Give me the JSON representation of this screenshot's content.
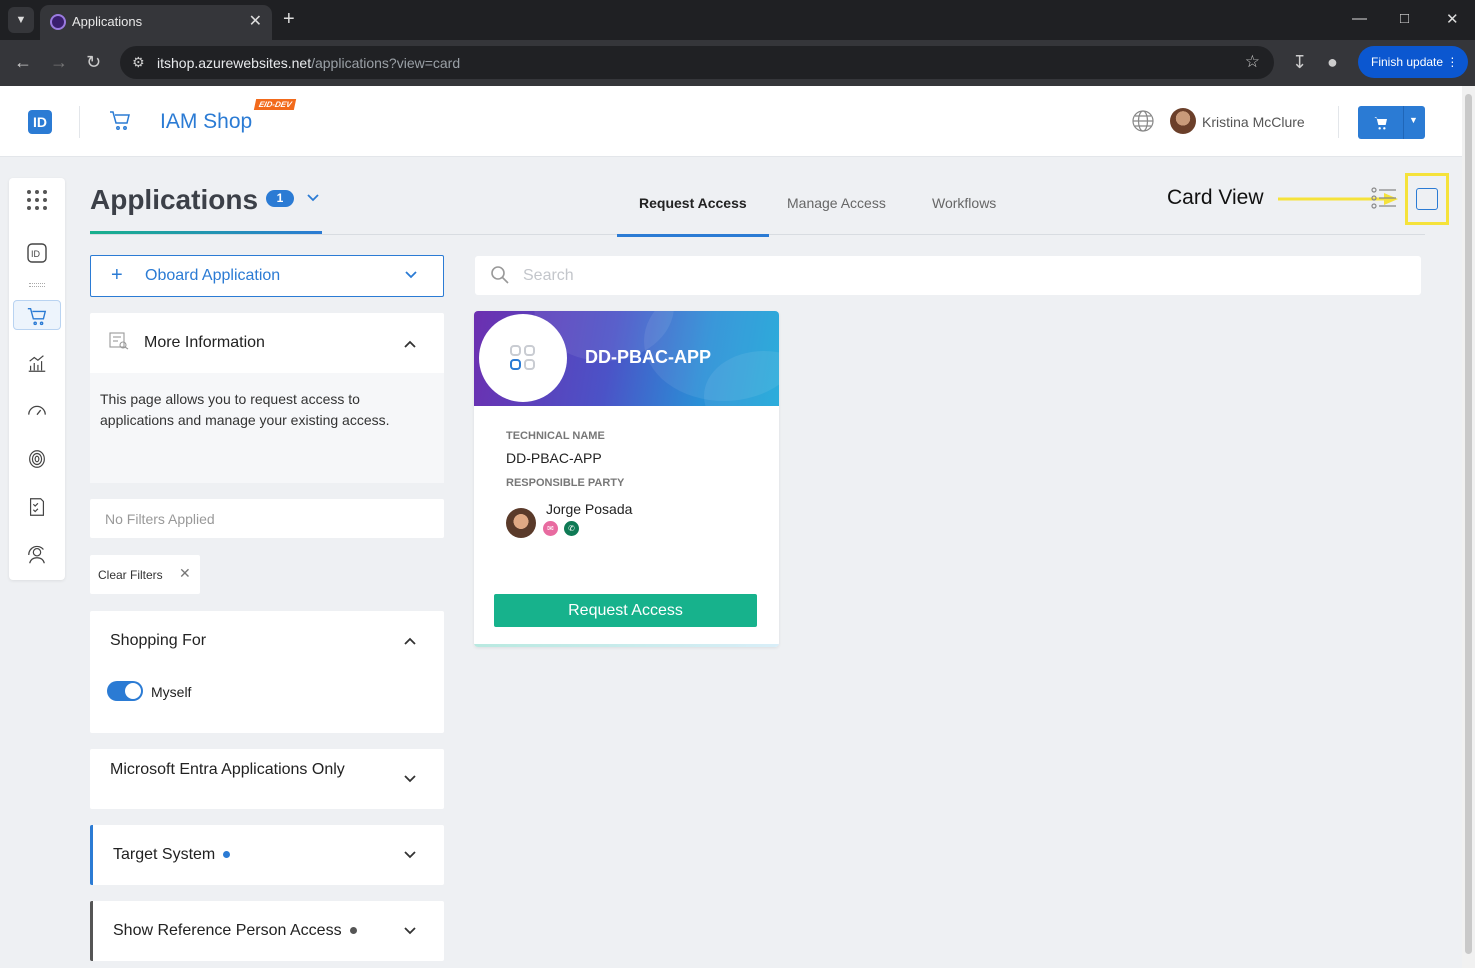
{
  "browser": {
    "tab_title": "Applications",
    "url_host": "itshop.azurewebsites.net",
    "url_path": "/applications?view=card",
    "finish_update": "Finish update"
  },
  "header": {
    "logo_text": "ID",
    "app_title": "IAM Shop",
    "env_badge": "EID-DEV",
    "user_name": "Kristina McClure"
  },
  "page": {
    "title": "Applications",
    "count": "1",
    "tabs": [
      {
        "label": "Request Access",
        "active": true
      },
      {
        "label": "Manage Access",
        "active": false
      },
      {
        "label": "Workflows",
        "active": false
      }
    ]
  },
  "annotation": {
    "text": "Card View",
    "color": "#f5e23a"
  },
  "sidebar_rail": {
    "items": [
      "apps-grid-icon",
      "id-icon",
      "cart-icon",
      "chart-icon",
      "gauge-icon",
      "fingerprint-icon",
      "checklist-icon",
      "user-shield-icon"
    ]
  },
  "filters": {
    "onboard_label": "Oboard Application",
    "more_info": {
      "title": "More Information",
      "body": "This page allows you to request access to applications and manage your existing access."
    },
    "no_filters": "No Filters Applied",
    "clear_filters": "Clear Filters",
    "shopping_for": {
      "title": "Shopping For",
      "toggle_label": "Myself",
      "toggle_on": true
    },
    "entra_only": "Microsoft Entra Applications Only",
    "target_system": "Target System",
    "reference_person": "Show Reference Person Access"
  },
  "search": {
    "placeholder": "Search",
    "value": ""
  },
  "cards": [
    {
      "name": "DD-PBAC-APP",
      "technical_name_label": "TECHNICAL NAME",
      "technical_name": "DD-PBAC-APP",
      "responsible_label": "RESPONSIBLE PARTY",
      "responsible_name": "Jorge Posada",
      "button": "Request Access"
    }
  ],
  "colors": {
    "primary": "#2b7bd4",
    "success": "#17b28c"
  }
}
